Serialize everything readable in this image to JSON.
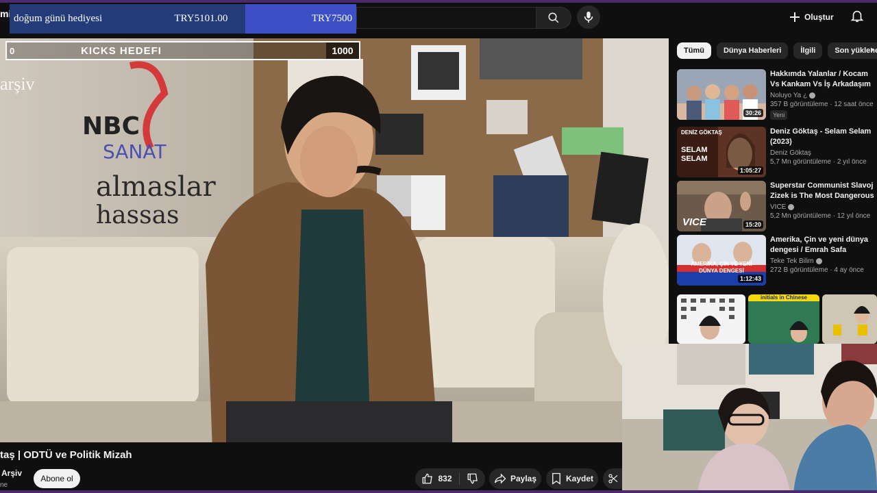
{
  "header": {
    "title_fragment": "mi",
    "create_label": "Oluştur",
    "search_placeholder": ""
  },
  "donation": {
    "title": "doğum günü hediyesi",
    "current": "TRY5101.00",
    "goal": "TRY7500"
  },
  "kicks_goal": {
    "start": "0",
    "label": "KICKS HEDEFI",
    "target": "1000"
  },
  "watermark": "arşiv",
  "video": {
    "title": "taş | ODTÜ ve Politik Mizah",
    "channel": "Arşiv",
    "channel_sub": "ne",
    "subscribe_label": "Abone ol",
    "likes": "832",
    "share_label": "Paylaş",
    "save_label": "Kaydet"
  },
  "chips": [
    "Tümü",
    "Dünya Haberleri",
    "İlgili",
    "Son yüklene"
  ],
  "recommendations": [
    {
      "title": "Hakkımda Yalanlar / Kocam Vs Kankam Vs İş Arkadaşım !",
      "channel": "Noluyo Ya ¿",
      "stats": "357 B görüntüleme · 12 saat önce",
      "badge": "Yeni",
      "duration": "30:26"
    },
    {
      "title": "Deniz Göktaş - Selam Selam (2023)",
      "channel": "Deniz Göktaş",
      "stats": "5,7 Mn görüntüleme · 2 yıl önce",
      "badge": "",
      "duration": "1:05:27"
    },
    {
      "title": "Superstar Communist Slavoj Zizek is The Most Dangerous ...",
      "channel": "VICE",
      "stats": "5,2 Mn görüntüleme · 12 yıl önce",
      "badge": "",
      "duration": "15:20"
    },
    {
      "title": "Amerika, Çin ve yeni dünya dengesi / Emrah Safa Gürkan ...",
      "channel": "Teke Tek Bilim",
      "stats": "272 B görüntüleme · 4 ay önce",
      "badge": "",
      "duration": "1:12:43"
    }
  ],
  "thumb_text": {
    "deniz": "SELAM SELAM",
    "deniz_top": "DENİZ GÖKTAŞ",
    "vice": "VICE",
    "amerika": "AMERİKA, ÇİN VE YENİ DÜNYA DENGESİ"
  },
  "shorts_caption": "initials in Chinese",
  "colors": {
    "accent_purple": "#4a2a6a",
    "donation_dark": "#233b78",
    "donation_light": "#3c4fc6"
  }
}
